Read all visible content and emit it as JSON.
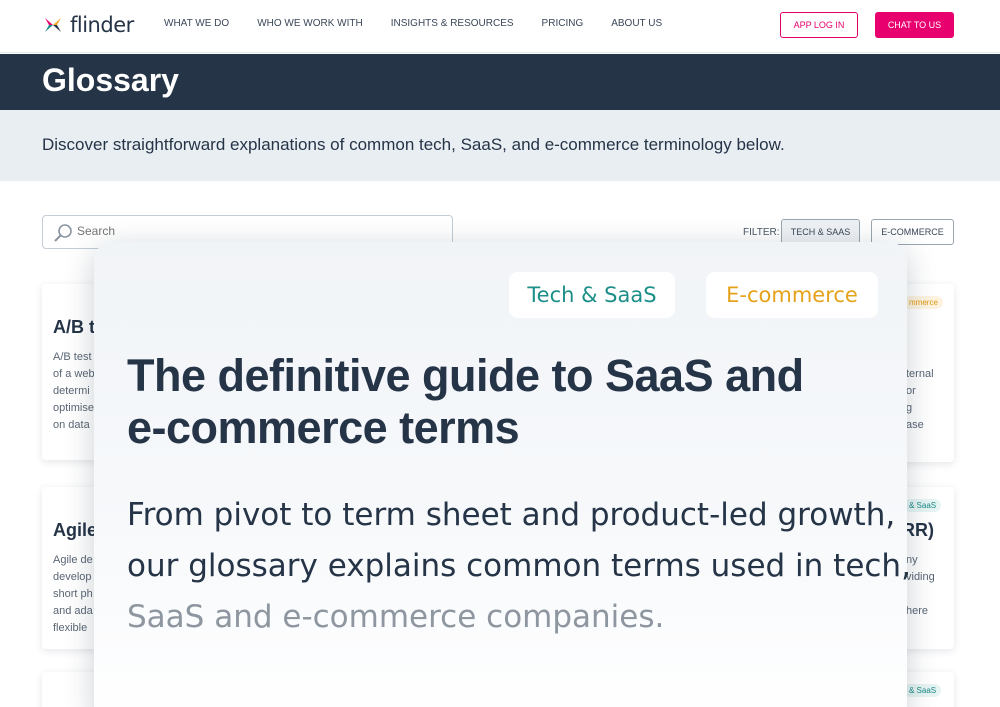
{
  "nav": {
    "logo_text": "flinder",
    "links": [
      "WHAT WE DO",
      "WHO WE WORK WITH",
      "INSIGHTS & RESOURCES",
      "PRICING",
      "ABOUT US"
    ],
    "login_label": "APP LOG IN",
    "chat_label": "CHAT TO US"
  },
  "header": {
    "title": "Glossary",
    "intro": "Discover straightforward explanations of common tech, SaaS, and e-commerce terminology below."
  },
  "search": {
    "placeholder": "Search"
  },
  "filter": {
    "label": "FILTER:",
    "chips": [
      "TECH & SAAS",
      "E-COMMERCE"
    ]
  },
  "cards": {
    "ab": {
      "title": "A/B t",
      "lines": [
        "A/B test",
        "of a web",
        "determi",
        "optimise",
        "on data"
      ]
    },
    "agile": {
      "title": "Agile",
      "lines": [
        "Agile de",
        "develop",
        "short ph",
        "and ada",
        "flexible"
      ]
    },
    "right_top": {
      "tag": "mmerce",
      "lines": [
        "ternal",
        "or",
        "g",
        "ase"
      ]
    },
    "right_mid": {
      "tag": "& SaaS",
      "title": "RR)",
      "lines": [
        "ny",
        "viding",
        "here"
      ]
    },
    "right_bot": {
      "tag": "& SaaS"
    }
  },
  "modal": {
    "tag_tech": "Tech & SaaS",
    "tag_ecom": "E-commerce",
    "heading_line1": "The definitive guide to SaaS and",
    "heading_line2": "e-commerce terms",
    "body_line1": "From pivot to term sheet and product-led growth,",
    "body_line2": "our glossary explains common terms used in tech,",
    "body_line3": "SaaS and e-commerce companies."
  },
  "colors": {
    "navy": "#253447",
    "brand_pink": "#e8006f",
    "tech_teal": "#1d8f89",
    "ecom_amber": "#e5a21a"
  }
}
